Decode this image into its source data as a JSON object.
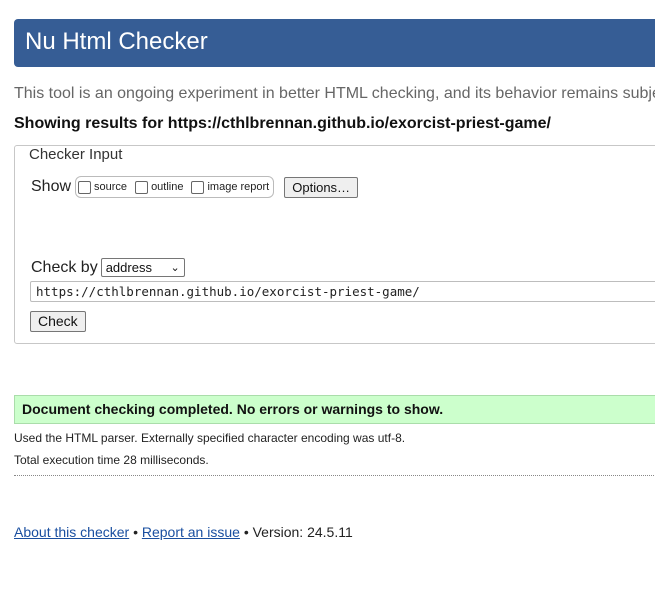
{
  "header": {
    "title": "Nu Html Checker"
  },
  "intro_text": "This tool is an ongoing experiment in better HTML checking, and its behavior remains subje",
  "results_for": "Showing results for https://cthlbrennan.github.io/exorcist-priest-game/",
  "checker_input": {
    "legend": "Checker Input",
    "show_label": "Show",
    "options": [
      {
        "label": "source",
        "checked": false
      },
      {
        "label": "outline",
        "checked": false
      },
      {
        "label": "image report",
        "checked": false
      }
    ],
    "options_button": "Options…",
    "check_by_label": "Check by",
    "check_by_value": "address",
    "url_value": "https://cthlbrennan.github.io/exorcist-priest-game/",
    "check_button": "Check"
  },
  "result": {
    "success_message": "Document checking completed. No errors or warnings to show.",
    "parser_info": "Used the HTML parser. Externally specified character encoding was utf-8.",
    "execution_time": "Total execution time 28 milliseconds."
  },
  "footer": {
    "about_link": "About this checker",
    "separator": "•",
    "report_link": "Report an issue",
    "version": "• Version: 24.5.11"
  },
  "colors": {
    "header_bg": "#365d95",
    "success_bg": "#ccffcc",
    "link": "#1a4fa0"
  }
}
